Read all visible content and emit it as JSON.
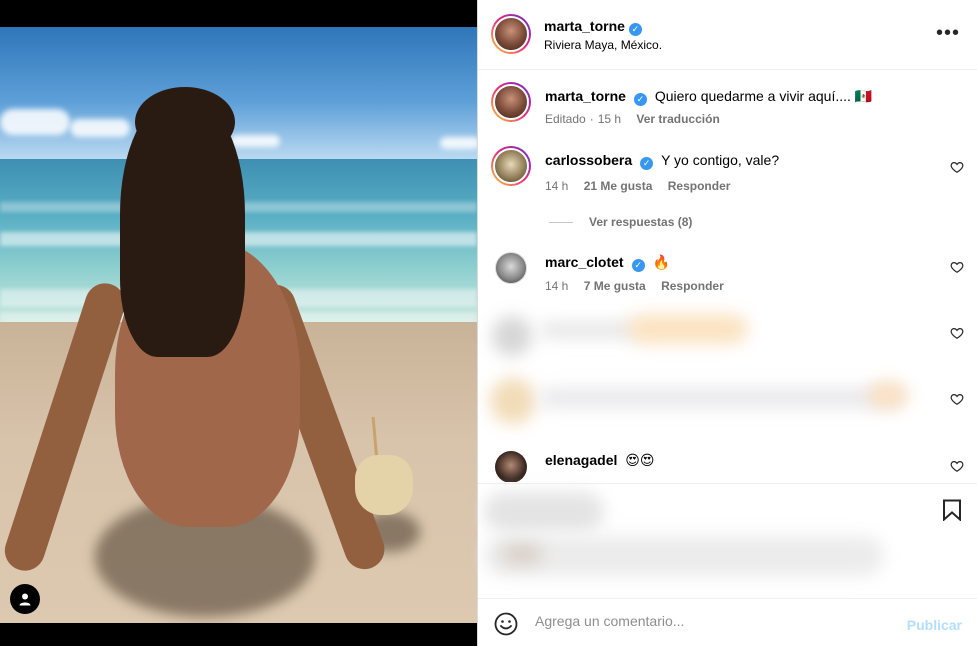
{
  "post": {
    "author": "marta_torne",
    "location": "Riviera Maya, México.",
    "caption": "Quiero quedarme a vivir aquí.... 🇲🇽",
    "caption_meta": {
      "edited": "Editado",
      "time": "15 h",
      "translate": "Ver traducción"
    }
  },
  "comments": [
    {
      "user": "carlossobera",
      "text": "Y yo contigo, vale?",
      "time": "14 h",
      "likes": "21 Me gusta",
      "reply": "Responder"
    },
    {
      "user": "marc_clotet",
      "text": "🔥",
      "time": "14 h",
      "likes": "7 Me gusta",
      "reply": "Responder"
    },
    {
      "user": "elenagadel",
      "text": "😍😍"
    }
  ],
  "replies_link": "Ver respuestas (8)",
  "composer": {
    "placeholder": "Agrega un comentario...",
    "publish": "Publicar"
  },
  "icons": {
    "verified": "verified-badge-icon",
    "more": "more-options-icon",
    "heart": "heart-icon",
    "bookmark": "bookmark-icon",
    "emoji": "emoji-icon",
    "user_tag": "user-tag-icon"
  },
  "colors": {
    "verified": "#3897f0",
    "publish": "#b2dffc",
    "meta": "#737373"
  }
}
